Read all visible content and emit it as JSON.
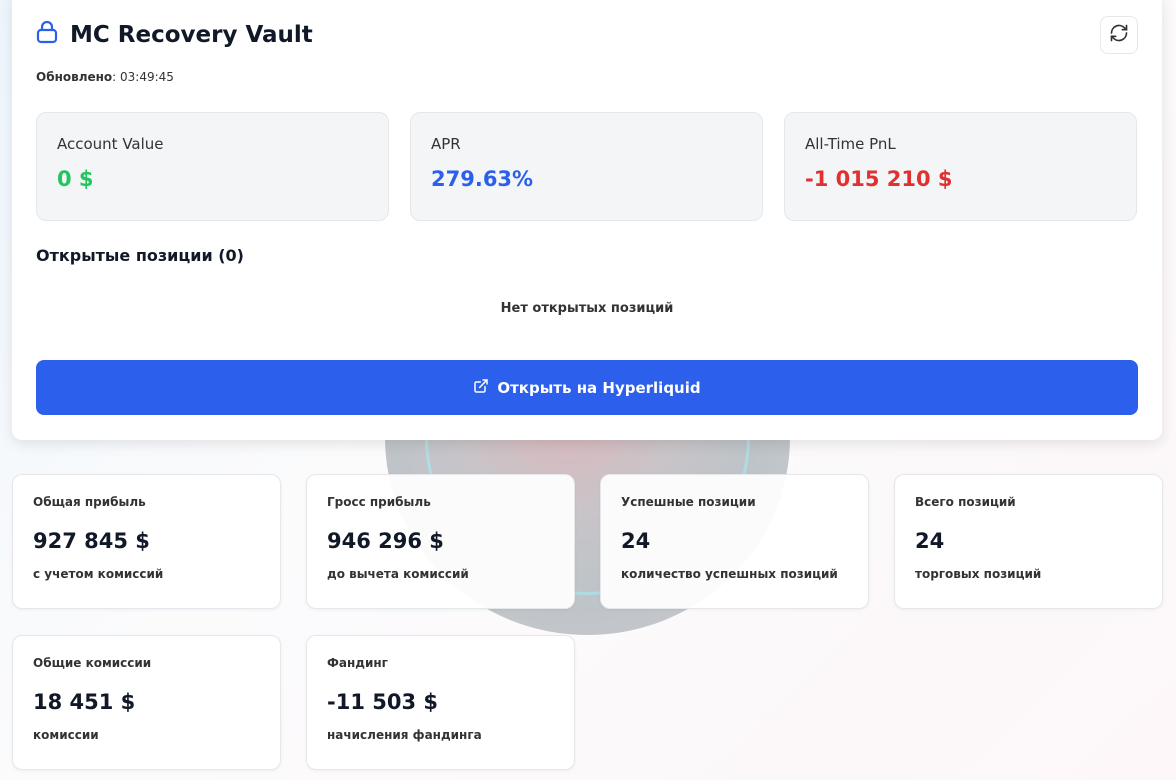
{
  "header": {
    "title": "MC Recovery Vault",
    "updated_label": "Обновлено",
    "updated_time": "03:49:45"
  },
  "stats": [
    {
      "label": "Account Value",
      "value": "0 $",
      "color": "#22c55e"
    },
    {
      "label": "APR",
      "value": "279.63%",
      "color": "#2b5fec"
    },
    {
      "label": "All-Time PnL",
      "value": "-1 015 210 $",
      "color": "#e03131"
    }
  ],
  "positions": {
    "title": "Открытые позиции (0)",
    "empty": "Нет открытых позиций"
  },
  "open_button": "Открыть на Hyperliquid",
  "cards": [
    {
      "title": "Общая прибыль",
      "value": "927 845 $",
      "sub": "с учетом комиссий"
    },
    {
      "title": "Гросс прибыль",
      "value": "946 296 $",
      "sub": "до вычета комиссий"
    },
    {
      "title": "Успешные позиции",
      "value": "24",
      "sub": "количество успешных позиций"
    },
    {
      "title": "Всего позиций",
      "value": "24",
      "sub": "торговых позиций"
    },
    {
      "title": "Общие комиссии",
      "value": "18 451 $",
      "sub": "комиссии"
    },
    {
      "title": "Фандинг",
      "value": "-11 503 $",
      "sub": "начисления фандинга"
    }
  ]
}
